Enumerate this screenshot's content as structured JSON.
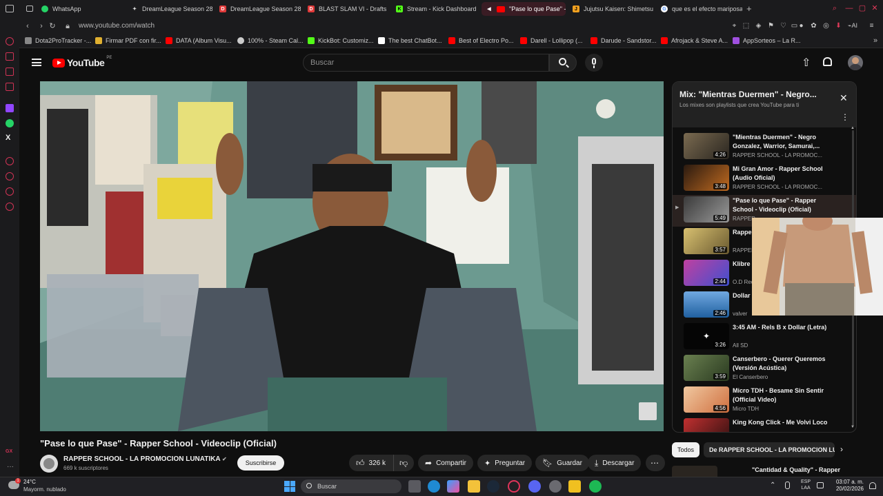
{
  "browser": {
    "tabs": [
      {
        "label": "WhatsApp",
        "icon": "whatsapp-icon",
        "color": "#25d366"
      },
      {
        "label": "DreamLeague Season 28",
        "icon": "pin-icon",
        "color": "#dddddd"
      },
      {
        "label": "DreamLeague Season 28",
        "icon": "d-icon",
        "color": "#e03a3a"
      },
      {
        "label": "BLAST SLAM VI - Drafts",
        "icon": "d-icon",
        "color": "#e03a3a"
      },
      {
        "label": "Stream - Kick Dashboard",
        "icon": "kick-icon",
        "color": "#53fc18"
      },
      {
        "label": "\"Pase lo que Pase\" - R",
        "icon": "speaker-icon",
        "color": "#ff0000"
      },
      {
        "label": "Jujutsu Kaisen: Shimetsu",
        "icon": "jk-icon",
        "color": "#f0a020"
      },
      {
        "label": "que es el efecto mariposa",
        "icon": "google-icon",
        "color": "#ffffff"
      }
    ],
    "url": "www.youtube.com/watch",
    "bookmarks": [
      {
        "label": "Dota2ProTracker -...",
        "color": "#888888"
      },
      {
        "label": "Firmar PDF con fir...",
        "color": "#e0b030"
      },
      {
        "label": "DATA (Album Visu...",
        "color": "#ff0000"
      },
      {
        "label": "100% - Steam Cal...",
        "color": "#cccccc"
      },
      {
        "label": "KickBot: Customiz...",
        "color": "#53fc18"
      },
      {
        "label": "The best ChatBot...",
        "color": "#ffffff"
      },
      {
        "label": "Best of Electro Po...",
        "color": "#ff0000"
      },
      {
        "label": "Darell - Lollipop (...",
        "color": "#ff0000"
      },
      {
        "label": "Darude - Sandstor...",
        "color": "#ff0000"
      },
      {
        "label": "Afrojack & Steve A...",
        "color": "#ff0000"
      },
      {
        "label": "AppSorteos – La R...",
        "color": "#a050e0"
      }
    ]
  },
  "youtube": {
    "logo_text": "YouTube",
    "region": "PE",
    "search_placeholder": "Buscar",
    "video": {
      "title": "\"Pase lo que Pase\" - Rapper School - Videoclip (Oficial)",
      "channel": "RAPPER SCHOOL - LA PROMOCION LUNATIKA",
      "subscribers": "669 k suscriptores",
      "subscribe_label": "Suscribirse",
      "likes": "326 k",
      "share_label": "Compartir",
      "ask_label": "Preguntar",
      "save_label": "Guardar",
      "download_label": "Descargar"
    },
    "playlist": {
      "title": "Mix: \"Mientras Duermen\" - Negro...",
      "subtitle": "Los mixes son playlists que crea YouTube para ti",
      "items": [
        {
          "title": "\"Mientras Duermen\" - Negro Gonzalez, Warrior, Samurai,...",
          "channel": "RAPPER SCHOOL - LA PROMOC...",
          "duration": "4:26"
        },
        {
          "title": "Mi Gran Amor - Rapper School (Audio Oficial)",
          "channel": "RAPPER SCHOOL - LA PROMOC...",
          "duration": "3:48"
        },
        {
          "title": "\"Pase lo que Pase\" - Rapper School - Videoclip (Oficial)",
          "channel": "RAPPER",
          "duration": "5:49"
        },
        {
          "title": "Rappe \"We D",
          "channel": "RAPPER",
          "duration": "3:57"
        },
        {
          "title": "Klibre",
          "channel": "O.D Rec",
          "duration": "2:44"
        },
        {
          "title": "Dollar Beats)",
          "channel": "valver",
          "duration": "2:46"
        },
        {
          "title": "3:45 AM - Rels B x Dollar (Letra)",
          "channel": "All SD",
          "duration": "3:26"
        },
        {
          "title": "Canserbero - Querer Queremos (Versión Acústica)",
          "channel": "El Canserbero",
          "duration": "3:59"
        },
        {
          "title": "Micro TDH - Besame Sin Sentir (Official Video)",
          "channel": "Micro TDH",
          "duration": "4:56"
        },
        {
          "title": "King Kong Click - Me Volvi Loco",
          "channel": "",
          "duration": ""
        }
      ]
    },
    "chips": [
      "Todos",
      "De RAPPER SCHOOL - LA PROMOCION LU"
    ],
    "next_item": "\"Cantidad & Quality\" - Rapper"
  },
  "taskbar": {
    "temperature": "24°C",
    "weather": "Mayorm. nublado",
    "search_placeholder": "Buscar",
    "lang_line1": "ESP",
    "lang_line2": "LAA",
    "time": "03:07 a. m.",
    "date": "20/02/2026"
  }
}
